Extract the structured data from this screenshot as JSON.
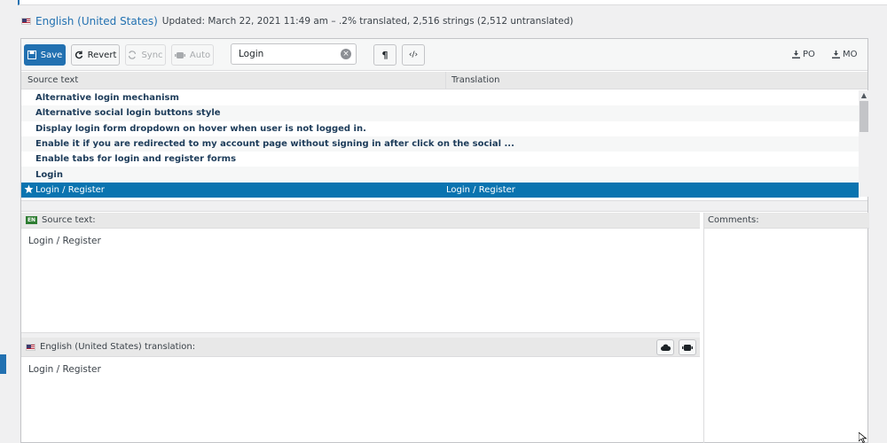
{
  "header": {
    "language": "English (United States)",
    "meta": "Updated: March 22, 2021 11:49 am – .2% translated, 2,516 strings (2,512 untranslated)"
  },
  "toolbar": {
    "save": "Save",
    "revert": "Revert",
    "sync": "Sync",
    "auto": "Auto",
    "search_value": "Login",
    "po": "PO",
    "mo": "MO"
  },
  "grid": {
    "col_source": "Source text",
    "col_translation": "Translation",
    "rows": [
      {
        "source": "Alternative login mechanism",
        "translation": ""
      },
      {
        "source": "Alternative social login buttons style",
        "translation": ""
      },
      {
        "source": "Display login form dropdown on hover when user is not logged in.",
        "translation": ""
      },
      {
        "source": "Enable it if you are redirected to my account page without signing in after click on the social ...",
        "translation": ""
      },
      {
        "source": "Enable tabs for login and register forms",
        "translation": ""
      },
      {
        "source": "Login",
        "translation": ""
      },
      {
        "source": "Login / Register",
        "translation": "Login / Register"
      }
    ]
  },
  "source_pane": {
    "label": "Source text:",
    "flag": "EN",
    "text": "Login / Register"
  },
  "translation_pane": {
    "label": "English (United States) translation:",
    "text": "Login / Register"
  },
  "comments": {
    "label": "Comments:"
  },
  "colors": {
    "accent": "#2271b1",
    "selected_row": "#0a74b0"
  }
}
